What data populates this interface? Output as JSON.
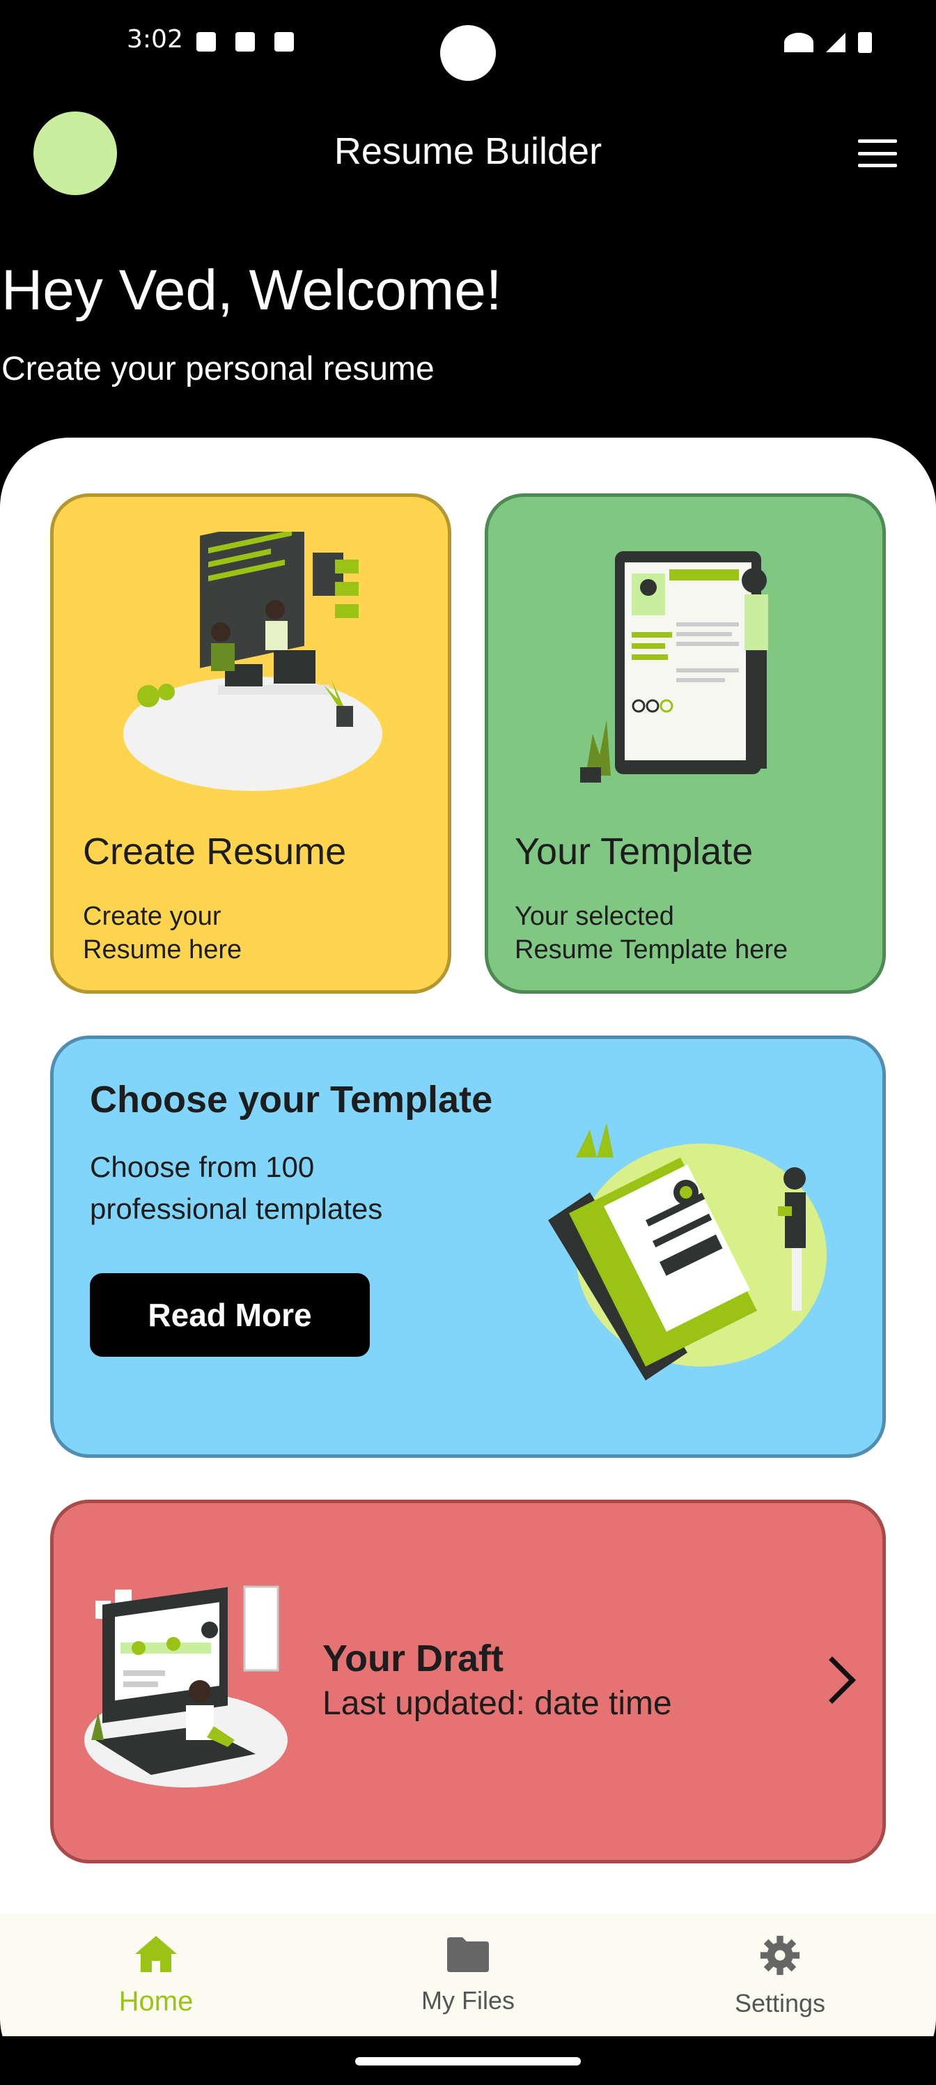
{
  "status_bar": {
    "time": "3:02"
  },
  "app_bar": {
    "title": "Resume Builder",
    "avatar_color": "#c8ee9e"
  },
  "welcome": {
    "heading": "Hey Ved, Welcome!",
    "subheading": "Create your personal resume"
  },
  "cards": {
    "create": {
      "title": "Create Resume",
      "desc_line1": "Create your",
      "desc_line2": "Resume here",
      "color": "#ffd54f"
    },
    "template": {
      "title": "Your Template",
      "desc_line1": "Your selected",
      "desc_line2": "Resume Template here",
      "color": "#81c784"
    },
    "choose": {
      "title": "Choose your Template",
      "desc_line1": "Choose from 100",
      "desc_line2": "professional templates",
      "button": "Read More",
      "color": "#81d4fa"
    },
    "draft": {
      "title": "Your Draft",
      "subtitle": "Last updated: date time",
      "color": "#e57373"
    }
  },
  "bottom_nav": {
    "items": [
      {
        "label": "Home",
        "icon": "home-icon",
        "active": true
      },
      {
        "label": "My Files",
        "icon": "folder-icon",
        "active": false
      },
      {
        "label": "Settings",
        "icon": "gear-icon",
        "active": false
      }
    ],
    "accent": "#9ac316"
  }
}
